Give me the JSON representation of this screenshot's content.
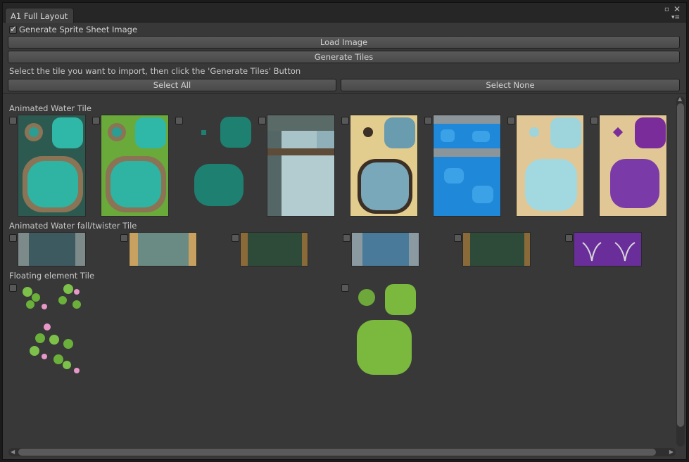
{
  "window": {
    "tab_title": "A1 Full Layout",
    "tab_menu_icon": "tab-menu-icon",
    "maximize_icon": "maximize-icon",
    "close_icon": "close-icon"
  },
  "options": {
    "generate_sprite_sheet_label": "Generate Sprite Sheet Image",
    "generate_sprite_sheet_checked": true
  },
  "buttons": {
    "load_image": "Load Image",
    "generate_tiles": "Generate Tiles",
    "select_all": "Select All",
    "select_none": "Select None"
  },
  "instruction": "Select the tile you want to import, then click the 'Generate Tiles' Button",
  "sections": [
    {
      "title": "Animated Water Tile"
    },
    {
      "title": "Animated Water fall/twister Tile"
    },
    {
      "title": "Floating element Tile"
    }
  ],
  "colors": {
    "window_bg": "#383838",
    "button_bg": "#595959",
    "text": "#c8c8c8"
  }
}
